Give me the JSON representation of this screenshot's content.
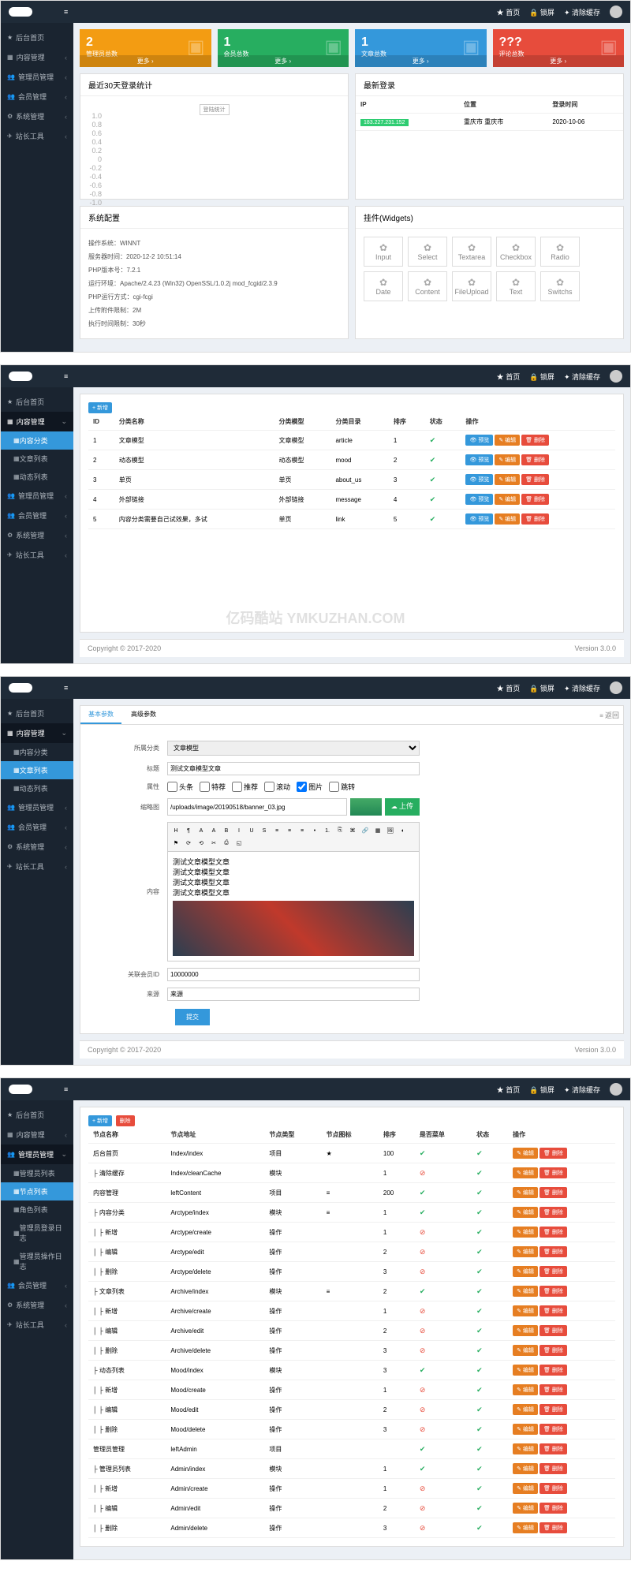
{
  "topbar": {
    "home": "首页",
    "lock": "锁屏",
    "clear": "清除缓存"
  },
  "sidebar": {
    "items": [
      {
        "label": "后台首页"
      },
      {
        "label": "内容管理"
      },
      {
        "label": "管理员管理"
      },
      {
        "label": "会员管理"
      },
      {
        "label": "系统管理"
      },
      {
        "label": "站长工具"
      }
    ],
    "content_sub": [
      {
        "label": "内容分类"
      },
      {
        "label": "文章列表"
      },
      {
        "label": "动态列表"
      }
    ],
    "admin_sub": [
      {
        "label": "管理员列表"
      },
      {
        "label": "节点列表"
      },
      {
        "label": "角色列表"
      },
      {
        "label": "管理员登录日志"
      },
      {
        "label": "管理员操作日志"
      }
    ]
  },
  "dashboard": {
    "stats": [
      {
        "num": "2",
        "label": "管理员总数",
        "color": "#f39c12"
      },
      {
        "num": "1",
        "label": "会员总数",
        "color": "#27ae60"
      },
      {
        "num": "1",
        "label": "文章总数",
        "color": "#3498db"
      },
      {
        "num": "???",
        "label": "评论总数",
        "color": "#e74c3c"
      }
    ],
    "more": "更多",
    "chart_title": "最近30天登录统计",
    "login_title": "最新登录",
    "login_headers": [
      "IP",
      "位置",
      "登录时间"
    ],
    "login_row": {
      "ip": "183.227.231.152",
      "loc": "重庆市 重庆市",
      "time": "2020-10-06"
    },
    "sys_title": "系统配置",
    "sys": [
      "操作系统：WINNT",
      "服务器时间：2020-12-2 10:51:14",
      "PHP版本号：7.2.1",
      "运行环境：Apache/2.4.23 (Win32) OpenSSL/1.0.2j mod_fcgid/2.3.9",
      "PHP运行方式：cgi-fcgi",
      "上传附件限制：2M",
      "执行时间限制：30秒"
    ],
    "widget_title": "挂件(Widgets)",
    "widgets": [
      "Input",
      "Select",
      "Textarea",
      "Checkbox",
      "Radio",
      "Date",
      "Content",
      "FileUpload",
      "Text",
      "Switchs"
    ]
  },
  "categories": {
    "add": "+ 新增",
    "headers": [
      "ID",
      "分类名称",
      "分类模型",
      "分类目录",
      "排序",
      "状态",
      "操作"
    ],
    "rows": [
      {
        "id": "1",
        "name": "文章模型",
        "model": "文章模型",
        "dir": "article",
        "sort": "1"
      },
      {
        "id": "2",
        "name": "动态模型",
        "model": "动态模型",
        "dir": "mood",
        "sort": "2"
      },
      {
        "id": "3",
        "name": "单页",
        "model": "单页",
        "dir": "about_us",
        "sort": "3"
      },
      {
        "id": "4",
        "name": "外部链接",
        "model": "外部链接",
        "dir": "message",
        "sort": "4"
      },
      {
        "id": "5",
        "name": "内容分类需要自己试效果，多试",
        "model": "单页",
        "dir": "link",
        "sort": "5"
      }
    ],
    "btns": {
      "preview": "预览",
      "edit": "编辑",
      "del": "删除"
    }
  },
  "article": {
    "tabs": [
      "基本参数",
      "高级参数"
    ],
    "back": "返回",
    "fields": {
      "cat_label": "所属分类",
      "cat_val": "文章模型",
      "title_label": "标题",
      "title_val": "测试文章模型文章",
      "attr_label": "属性",
      "attrs": [
        "头条",
        "特荐",
        "推荐",
        "滚动",
        "图片",
        "跳转"
      ],
      "thumb_label": "缩略图",
      "thumb_val": "/uploads/image/20190518/banner_03.jpg",
      "upload": "上传",
      "content_label": "内容",
      "content_lines": [
        "测试文章模型文章",
        "测试文章模型文章",
        "测试文章模型文章",
        "测试文章模型文章"
      ],
      "relid_label": "关联会员ID",
      "relid_val": "10000000",
      "source_label": "来源",
      "source_val": "来源",
      "submit": "提交"
    }
  },
  "nodes": {
    "add": "+ 新增",
    "del": "删除",
    "headers": [
      "节点名称",
      "节点地址",
      "节点类型",
      "节点图标",
      "排序",
      "是否菜单",
      "状态",
      "操作"
    ],
    "rows": [
      {
        "name": "后台首页",
        "addr": "Index/index",
        "type": "项目",
        "icon": "★",
        "sort": "100",
        "menu": "ok",
        "status": "ok"
      },
      {
        "name": "├ 清除缓存",
        "addr": "Index/cleanCache",
        "type": "模块",
        "icon": "",
        "sort": "1",
        "menu": "no",
        "status": "ok"
      },
      {
        "name": "内容管理",
        "addr": "leftContent",
        "type": "项目",
        "icon": "≡",
        "sort": "200",
        "menu": "ok",
        "status": "ok"
      },
      {
        "name": "├ 内容分类",
        "addr": "Arctype/index",
        "type": "模块",
        "icon": "≡",
        "sort": "1",
        "menu": "ok",
        "status": "ok"
      },
      {
        "name": "│ ├ 新增",
        "addr": "Arctype/create",
        "type": "操作",
        "icon": "",
        "sort": "1",
        "menu": "no",
        "status": "ok"
      },
      {
        "name": "│ ├ 编辑",
        "addr": "Arctype/edit",
        "type": "操作",
        "icon": "",
        "sort": "2",
        "menu": "no",
        "status": "ok"
      },
      {
        "name": "│ ├ 删除",
        "addr": "Arctype/delete",
        "type": "操作",
        "icon": "",
        "sort": "3",
        "menu": "no",
        "status": "ok"
      },
      {
        "name": "├ 文章列表",
        "addr": "Archive/index",
        "type": "模块",
        "icon": "≡",
        "sort": "2",
        "menu": "ok",
        "status": "ok"
      },
      {
        "name": "│ ├ 新增",
        "addr": "Archive/create",
        "type": "操作",
        "icon": "",
        "sort": "1",
        "menu": "no",
        "status": "ok"
      },
      {
        "name": "│ ├ 编辑",
        "addr": "Archive/edit",
        "type": "操作",
        "icon": "",
        "sort": "2",
        "menu": "no",
        "status": "ok"
      },
      {
        "name": "│ ├ 删除",
        "addr": "Archive/delete",
        "type": "操作",
        "icon": "",
        "sort": "3",
        "menu": "no",
        "status": "ok"
      },
      {
        "name": "├ 动态列表",
        "addr": "Mood/index",
        "type": "模块",
        "icon": "",
        "sort": "3",
        "menu": "ok",
        "status": "ok"
      },
      {
        "name": "│ ├ 新增",
        "addr": "Mood/create",
        "type": "操作",
        "icon": "",
        "sort": "1",
        "menu": "no",
        "status": "ok"
      },
      {
        "name": "│ ├ 编辑",
        "addr": "Mood/edit",
        "type": "操作",
        "icon": "",
        "sort": "2",
        "menu": "no",
        "status": "ok"
      },
      {
        "name": "│ ├ 删除",
        "addr": "Mood/delete",
        "type": "操作",
        "icon": "",
        "sort": "3",
        "menu": "no",
        "status": "ok"
      },
      {
        "name": "管理员管理",
        "addr": "leftAdmin",
        "type": "项目",
        "icon": "",
        "sort": "",
        "menu": "ok",
        "status": "ok"
      },
      {
        "name": "├ 管理员列表",
        "addr": "Admin/index",
        "type": "模块",
        "icon": "",
        "sort": "1",
        "menu": "ok",
        "status": "ok"
      },
      {
        "name": "│ ├ 新增",
        "addr": "Admin/create",
        "type": "操作",
        "icon": "",
        "sort": "1",
        "menu": "no",
        "status": "ok"
      },
      {
        "name": "│ ├ 编辑",
        "addr": "Admin/edit",
        "type": "操作",
        "icon": "",
        "sort": "2",
        "menu": "no",
        "status": "ok"
      },
      {
        "name": "│ ├ 删除",
        "addr": "Admin/delete",
        "type": "操作",
        "icon": "",
        "sort": "3",
        "menu": "no",
        "status": "ok"
      }
    ]
  },
  "footer": {
    "left": "Copyright © 2017-2020",
    "right": "Version 3.0.0"
  },
  "watermark": "亿码酷站 YMKUZHAN.COM",
  "chart_data": {
    "type": "line",
    "title": "最近30天登录统计",
    "ylim": [
      -1.0,
      1.0
    ],
    "ticks": [
      "1.0",
      "0.8",
      "0.6",
      "0.4",
      "0.2",
      "0",
      "-0.2",
      "-0.4",
      "-0.6",
      "-0.8",
      "-1.0"
    ],
    "legend": "登陆统计",
    "values": []
  }
}
